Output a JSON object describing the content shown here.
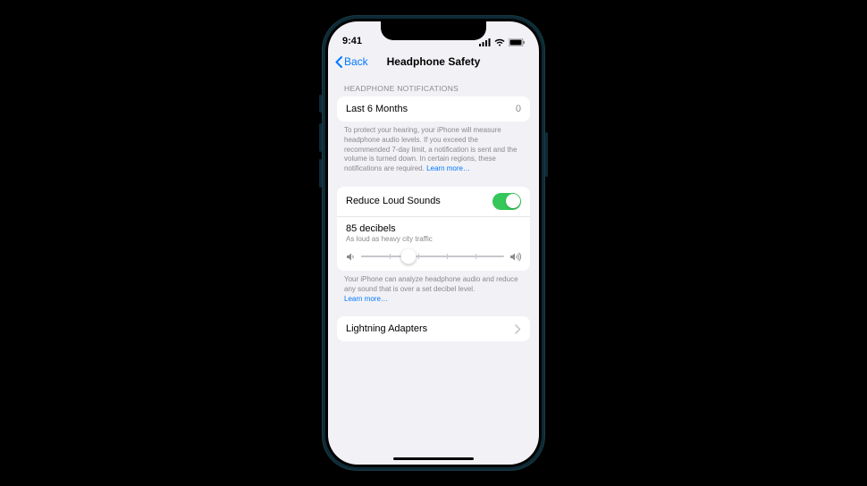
{
  "status": {
    "time": "9:41"
  },
  "nav": {
    "back": "Back",
    "title": "Headphone Safety"
  },
  "sections": {
    "notifications": {
      "header": "HEADPHONE NOTIFICATIONS",
      "row_label": "Last 6 Months",
      "row_value": "0",
      "footer": "To protect your hearing, your iPhone will measure headphone audio levels. If you exceed the recommended 7-day limit, a notification is sent and the volume is turned down. In certain regions, these notifications are required.",
      "learn_more": "Learn more…"
    },
    "reduce": {
      "toggle_label": "Reduce Loud Sounds",
      "toggle_on": true,
      "db_label": "85 decibels",
      "db_sub": "As loud as heavy city traffic",
      "slider_value": 85,
      "slider_min": 75,
      "slider_max": 100,
      "footer": "Your iPhone can analyze headphone audio and reduce any sound that is over a set decibel level.",
      "learn_more": "Learn more…"
    },
    "adapters": {
      "label": "Lightning Adapters"
    }
  }
}
